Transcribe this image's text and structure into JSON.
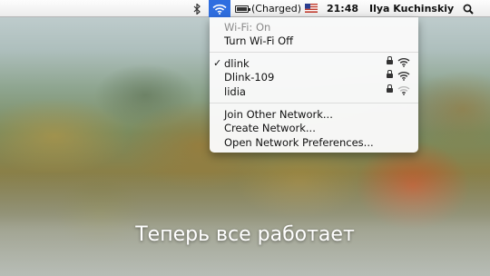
{
  "menubar": {
    "bluetooth_icon": "bluetooth-icon",
    "wifi_icon": "wifi-icon",
    "wifi_accent": "#2f6ee0",
    "battery_icon": "battery-icon",
    "battery_status": "(Charged)",
    "battery_level": 1.0,
    "flag_icon": "us-flag-icon",
    "time": "21:48",
    "user": "Ilya Kuchinskiy",
    "spotlight_icon": "magnifier-icon"
  },
  "wifi_menu": {
    "status": "Wi-Fi: On",
    "toggle": "Turn Wi-Fi Off",
    "networks": [
      {
        "name": "dlink",
        "selected": true,
        "locked": true,
        "signal_icon": "wifi-signal-icon"
      },
      {
        "name": "Dlink-109",
        "selected": false,
        "locked": true,
        "signal_icon": "wifi-signal-icon"
      },
      {
        "name": "lidia",
        "selected": false,
        "locked": true,
        "signal_icon": "wifi-signal-icon"
      }
    ],
    "check_glyph": "✓",
    "actions": [
      "Join Other Network...",
      "Create Network...",
      "Open Network Preferences..."
    ]
  },
  "caption": "Теперь все работает"
}
